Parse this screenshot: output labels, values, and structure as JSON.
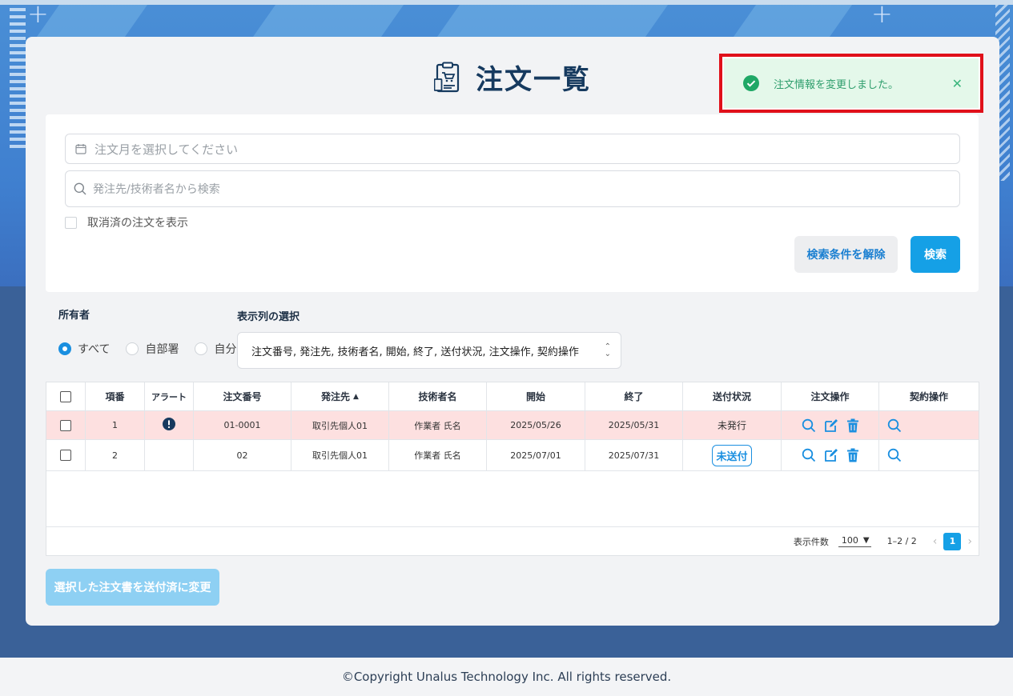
{
  "page": {
    "title": "注文一覧"
  },
  "toast": {
    "message": "注文情報を変更しました。"
  },
  "search": {
    "month_placeholder": "注文月を選択してください",
    "keyword_placeholder": "発注先/技術者名から検索",
    "show_cancelled_label": "取消済の注文を表示",
    "clear_label": "検索条件を解除",
    "search_label": "検索"
  },
  "owner": {
    "label": "所有者",
    "options": [
      "すべて",
      "自部署",
      "自分"
    ],
    "selected": "すべて"
  },
  "columns_select": {
    "label": "表示列の選択",
    "value": "注文番号, 発注先, 技術者名, 開始, 終了, 送付状況, 注文操作, 契約操作"
  },
  "table": {
    "headers": [
      "項番",
      "アラート",
      "注文番号",
      "発注先",
      "技術者名",
      "開始",
      "終了",
      "送付状況",
      "注文操作",
      "契約操作"
    ],
    "sort_column": "発注先",
    "rows": [
      {
        "no": "1",
        "alert": true,
        "order_no": "01-0001",
        "vendor": "取引先個人01",
        "engineer": "作業者 氏名",
        "start": "2025/05/26",
        "end": "2025/05/31",
        "status": "未発行",
        "status_badge": false
      },
      {
        "no": "2",
        "alert": false,
        "order_no": "02",
        "vendor": "取引先個人01",
        "engineer": "作業者 氏名",
        "start": "2025/07/01",
        "end": "2025/07/31",
        "status": "未送付",
        "status_badge": true
      }
    ],
    "rows_per_page_label": "表示件数",
    "rows_per_page": "100",
    "range": "1–2 / 2",
    "current_page": "1"
  },
  "bulk_action_label": "選択した注文書を送付済に変更",
  "footer": {
    "copyright": "©Copyright Unalus Technology Inc. All rights reserved."
  },
  "colors": {
    "accent": "#15a0e6",
    "title": "#163a5f",
    "alert_row": "#fde0e0",
    "toast_bg": "#e4f8ea",
    "toast_border": "#e0101a"
  }
}
